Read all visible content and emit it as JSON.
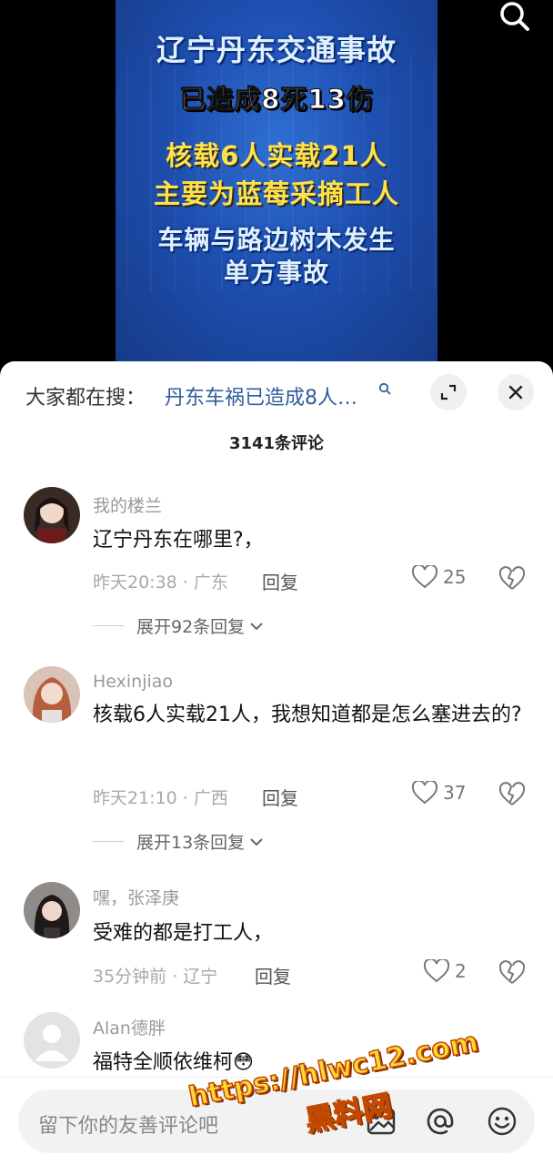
{
  "video": {
    "headline": "辽宁丹东交通事故",
    "line2": "已造成8死13伤",
    "line3": "核载6人实载21人",
    "line4": "主要为蓝莓采摘工人",
    "line5": "车辆与路边树木发生",
    "line6": "单方事故",
    "search_icon": "search-icon"
  },
  "comments_sheet": {
    "hot_search_label": "大家都在搜：",
    "hot_search_query": "丹东车祸已造成8人…",
    "comment_count": "3141条评论",
    "comments": [
      {
        "user": "我的楼兰",
        "text": "辽宁丹东在哪里?，",
        "time_location": "昨天20:38 · 广东",
        "reply_label": "回复",
        "likes": "25",
        "expand": "展开92条回复"
      },
      {
        "user": "Hexinjiao",
        "text": "核载6人实载21人，我想知道都是怎么塞进去的?",
        "time_location": "昨天21:10 · 广西",
        "reply_label": "回复",
        "likes": "37",
        "expand": "展开13条回复"
      },
      {
        "user": "嘿，张泽庚",
        "text": "受难的都是打工人，",
        "time_location": "35分钟前 · 辽宁",
        "reply_label": "回复",
        "likes": "2"
      },
      {
        "user": "Alan德胖",
        "text": "福特全顺依维柯😳"
      }
    ],
    "input_placeholder": "留下你的友善评论吧"
  },
  "watermark": {
    "url": "https://hlwc12.com",
    "brand": "黑料网"
  },
  "colors": {
    "link_blue": "#2f5e9c",
    "watermark_yellow": "#ffd83a",
    "poster_blue": "#1e4fb0"
  }
}
